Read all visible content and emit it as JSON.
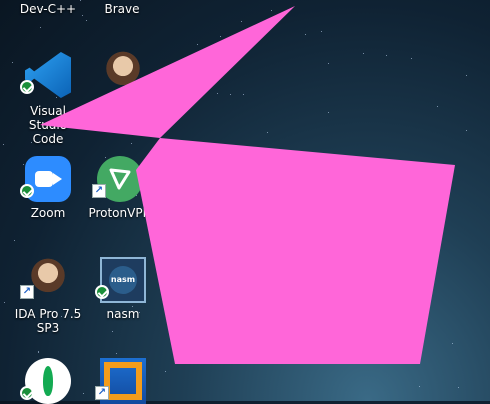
{
  "desktop": {
    "top_row": [
      {
        "label": "Dev-C++"
      },
      {
        "label": "Brave"
      }
    ],
    "icons": [
      {
        "label": "Visual Studio Code",
        "icon": "vscode-icon"
      },
      {
        "label": "Zoom",
        "icon": "zoom-icon"
      },
      {
        "label": "ProtonVPN",
        "icon": "protonvpn-icon"
      },
      {
        "label": "IDA Pro 7.5 SP3",
        "icon": "portrait-icon"
      },
      {
        "label": "nasm",
        "icon": "nasm-icon"
      },
      {
        "label": "",
        "icon": "mongodb-icon"
      },
      {
        "label": "",
        "icon": "virtualbox-icon"
      }
    ],
    "nasm_icon_text": "nasm",
    "annotation_color": "#ff66d9"
  }
}
